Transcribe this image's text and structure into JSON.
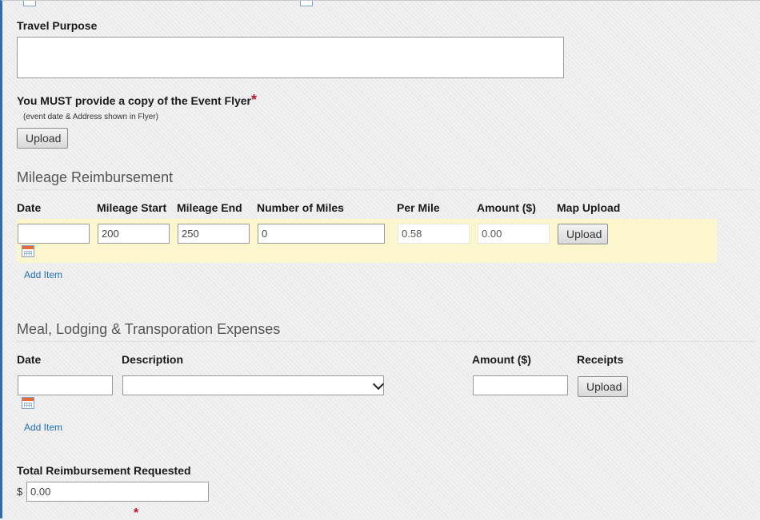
{
  "travel_purpose": {
    "label": "Travel Purpose",
    "value": ""
  },
  "event_flyer": {
    "label": "You MUST provide a copy of the Event Flyer",
    "required_mark": "*",
    "note": "(event date & Address shown in Flyer)",
    "upload_label": "Upload"
  },
  "mileage": {
    "title": "Mileage Reimbursement",
    "columns": [
      "Date",
      "Mileage Start",
      "Mileage End",
      "Number of Miles",
      "Per Mile",
      "Amount ($)",
      "Map Upload"
    ],
    "row": {
      "date": "",
      "mileage_start": "200",
      "mileage_end": "250",
      "number_of_miles": "0",
      "per_mile": "0.58",
      "amount": "0.00",
      "upload_label": "Upload"
    },
    "add_item": "Add Item"
  },
  "expenses": {
    "title": "Meal, Lodging & Transporation Expenses",
    "columns": [
      "Date",
      "Description",
      "Amount ($)",
      "Receipts"
    ],
    "row": {
      "date": "",
      "description": "",
      "amount": "",
      "upload_label": "Upload"
    },
    "add_item": "Add Item"
  },
  "total": {
    "label": "Total Reimbursement Requested",
    "currency": "$",
    "value": "0.00"
  },
  "bottom_required_mark": "*",
  "colors": {
    "accent_border": "#2c6db0",
    "row_highlight": "#fbf6cd",
    "link": "#1f6fb3",
    "required": "#b0172a"
  }
}
